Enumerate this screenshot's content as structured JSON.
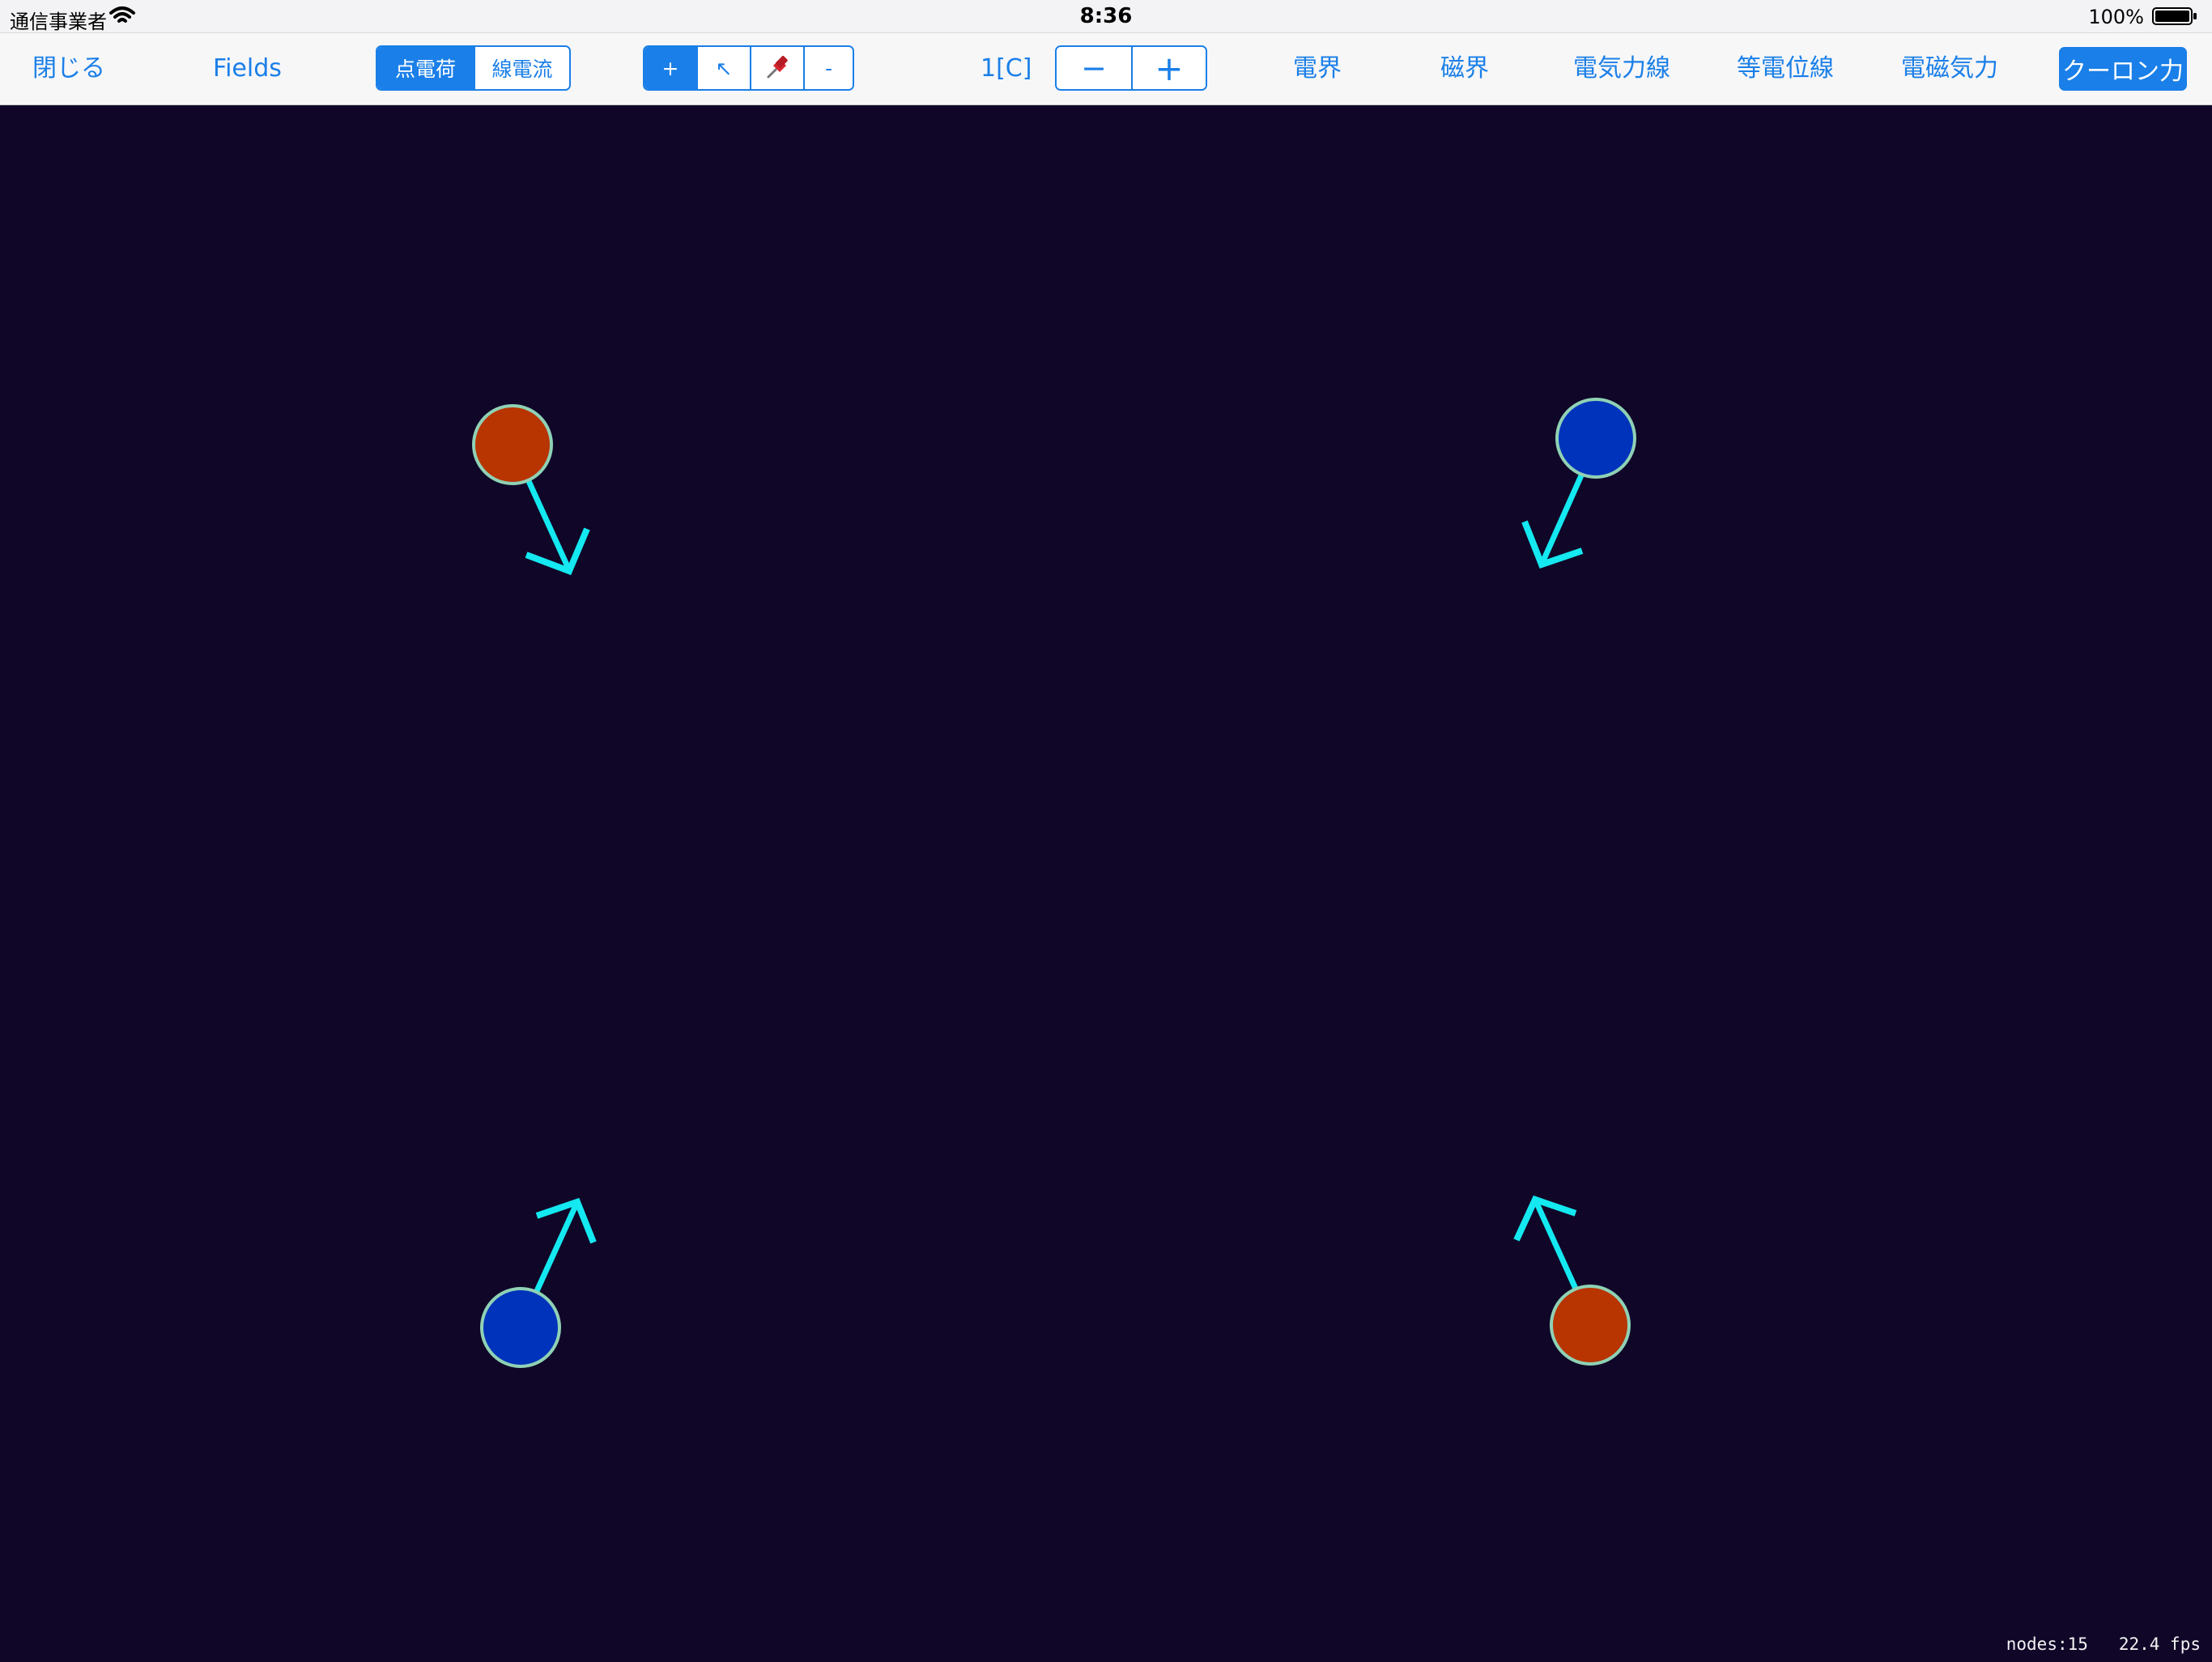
{
  "status_bar": {
    "carrier": "通信事業者",
    "time": "8:36",
    "battery_percent": "100%",
    "battery_level": 1.0
  },
  "toolbar": {
    "close_label": "閉じる",
    "title": "Fields",
    "charge_type_segment": [
      {
        "label": "点電荷",
        "selected": true
      },
      {
        "label": "線電流",
        "selected": false
      }
    ],
    "tool_segment": [
      {
        "label": "+",
        "selected": true
      },
      {
        "icon": "cursor-arrow-icon",
        "label": "↖",
        "selected": false
      },
      {
        "icon": "pin-icon",
        "label": "📌",
        "selected": false
      },
      {
        "label": "-",
        "selected": false
      }
    ],
    "charge_value": "1[C]",
    "stepper": {
      "minus": "−",
      "plus": "+"
    },
    "display_toggles": [
      {
        "label": "電界",
        "selected": false
      },
      {
        "label": "磁界",
        "selected": false
      },
      {
        "label": "電気力線",
        "selected": false
      },
      {
        "label": "等電位線",
        "selected": false
      },
      {
        "label": "電磁気力",
        "selected": false
      }
    ],
    "coulomb_force": {
      "label": "クーロン力",
      "selected": true
    }
  },
  "simulation": {
    "background_color": "#0f0628",
    "positive_color": "#b83400",
    "negative_color": "#0033bb",
    "ring_color": "#8fd1b5",
    "force_arrow_color": "#14e8f0",
    "charges": [
      {
        "sign": "positive",
        "force_direction": "down-right"
      },
      {
        "sign": "negative",
        "force_direction": "down-left"
      },
      {
        "sign": "negative",
        "force_direction": "up-right"
      },
      {
        "sign": "positive",
        "force_direction": "up-left"
      }
    ],
    "nodes_text": "nodes:15",
    "fps_text": "22.4 fps"
  }
}
